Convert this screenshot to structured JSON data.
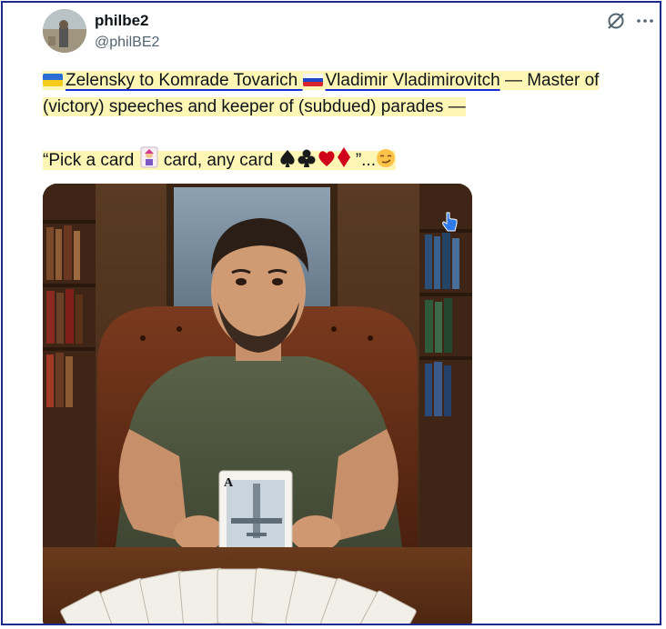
{
  "author": {
    "display_name": "philbe2",
    "handle": "@philBE2"
  },
  "tweet": {
    "line1": {
      "part1": "Zelensky to Komrade Tovarich ",
      "part2": "Vladimir Vladimirovitch",
      "part3": " — Master of"
    },
    "line2": "(victory) speeches and keeper of (subdued) parades —",
    "line3": {
      "part1": "“Pick a card ",
      "part2": " card, any card ",
      "part3": " ”..."
    }
  },
  "card": {
    "rank": "A"
  },
  "icons": [
    "grok-icon",
    "more-icon",
    "ukraine-flag-icon",
    "russia-flag-icon",
    "joker-icon",
    "spade-icon",
    "club-icon",
    "heart-icon",
    "diamond-icon",
    "smirk-emoji-icon",
    "cursor-hand-icon"
  ],
  "colors": {
    "highlight": "#fdf6b5",
    "underline": "#1a2ad8",
    "frame": "#1b2a8f",
    "heart": "#d0021b"
  }
}
